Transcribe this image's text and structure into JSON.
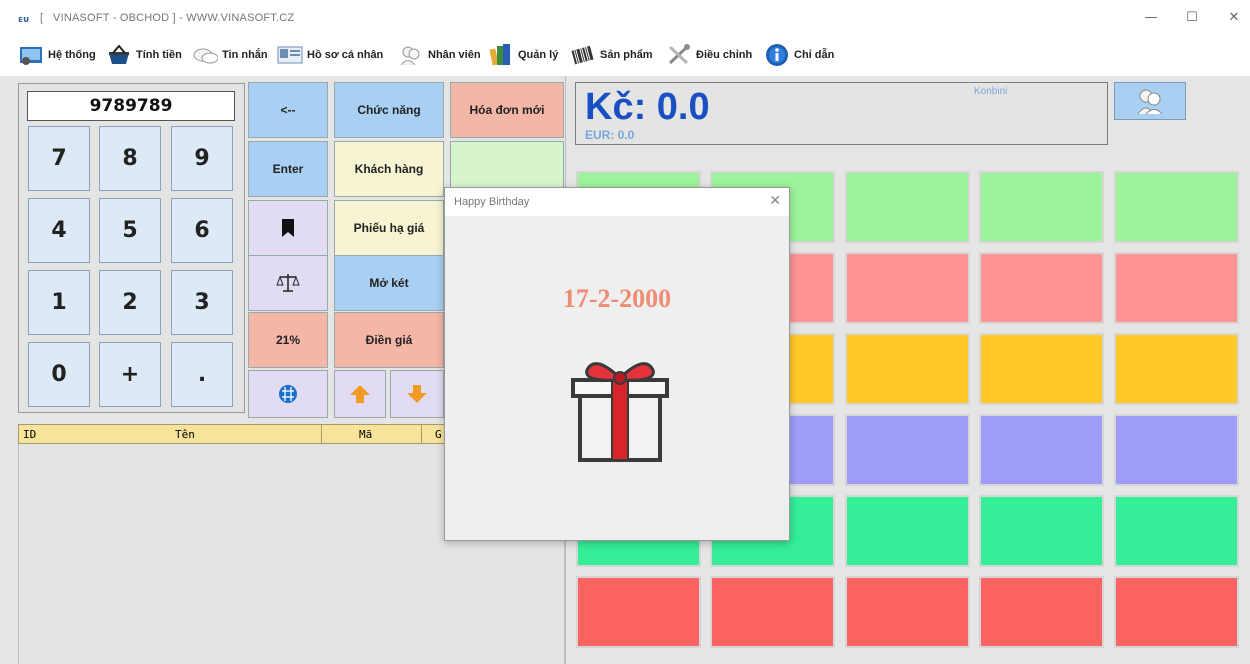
{
  "window": {
    "title": "VINASOFT - OBCHOD  ] - WWW.VINASOFT.CZ",
    "title_prefix": "[",
    "minimize": "—",
    "maximize": "☐",
    "close": "✕"
  },
  "menu": [
    {
      "label": "Hệ thống",
      "icon": "system-icon"
    },
    {
      "label": "Tính tiền",
      "icon": "basket-icon"
    },
    {
      "label": "Tin nhắn",
      "icon": "chat-icon"
    },
    {
      "label": "Hồ sơ cá nhân",
      "icon": "profile-card-icon"
    },
    {
      "label": "Nhân viên",
      "icon": "staff-icon"
    },
    {
      "label": "Quản lý",
      "icon": "books-icon"
    },
    {
      "label": "Sản phẩm",
      "icon": "barcode-icon"
    },
    {
      "label": "Điều chỉnh",
      "icon": "tools-icon"
    },
    {
      "label": "Chỉ dẫn",
      "icon": "info-icon"
    }
  ],
  "keypad": {
    "display": "9789789",
    "keys": [
      "7",
      "8",
      "9",
      "4",
      "5",
      "6",
      "1",
      "2",
      "3",
      "0",
      "+",
      "."
    ]
  },
  "functions": {
    "backspace": "<--",
    "chuc_nang": "Chức năng",
    "hoa_don_moi": "Hóa đơn mới",
    "enter": "Enter",
    "khach_hang": "Khách hàng",
    "phieu_ha_gia": "Phiếu hạ giá",
    "mo_ket": "Mở két",
    "vat": "21%",
    "dien_gia": "Điền giá"
  },
  "table": {
    "columns": [
      "ID",
      "Tên",
      "Mã",
      "G"
    ]
  },
  "totals": {
    "kc": "Kč: 0.0",
    "eur": "EUR: 0.0",
    "store": "Konbini"
  },
  "dialog": {
    "title": "Happy Birthday",
    "close": "✕",
    "date": "17-2-2000"
  },
  "colors": {
    "accent_blue": "#1a4fc4",
    "tile_green": "#9cf49a",
    "tile_pink": "#ff9494",
    "tile_yellow": "#ffc928",
    "tile_purple": "#9f9df7",
    "tile_teal": "#34ee98",
    "tile_red": "#ff6464"
  }
}
